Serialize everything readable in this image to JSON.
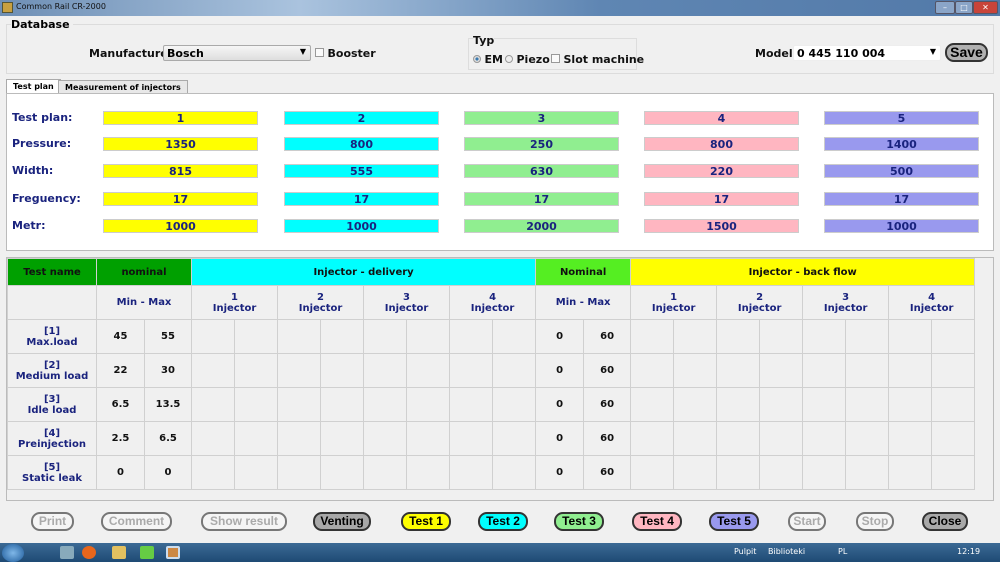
{
  "window": {
    "title": "Common Rail CR-2000",
    "minimize": "–",
    "maximize": "□",
    "close": "✕"
  },
  "database": {
    "label": "Database",
    "manufacture_label": "Manufacture:",
    "manufacture_value": "Bosch",
    "booster_label": "Booster",
    "typ_label": "Typ",
    "typ_options": [
      "EM",
      "Piezo"
    ],
    "typ_selected": "EM",
    "slot_label": "Slot machine",
    "model_label": "Model:",
    "model_value": "0 445 110 004",
    "save": "Save"
  },
  "tabs": [
    "Test plan",
    "Measurement of injectors"
  ],
  "plan": {
    "row_labels": [
      "Test plan:",
      "Pressure:",
      "Width:",
      "Freguency:",
      "Metr:"
    ],
    "colors": [
      "#ffff00",
      "#00ffff",
      "#90ee90",
      "#ffb6c1",
      "#9999ee"
    ],
    "columns": [
      [
        "1",
        "1350",
        "815",
        "17",
        "1000"
      ],
      [
        "2",
        "800",
        "555",
        "17",
        "1000"
      ],
      [
        "3",
        "250",
        "630",
        "17",
        "2000"
      ],
      [
        "4",
        "800",
        "220",
        "17",
        "1500"
      ],
      [
        "5",
        "1400",
        "500",
        "17",
        "1000"
      ]
    ]
  },
  "table": {
    "h_test": "Test name",
    "h_nominal": "nominal",
    "h_delivery": "Injector - delivery",
    "h_nominal2": "Nominal",
    "h_backflow": "Injector - back flow",
    "minmax": "Min - Max",
    "inj": [
      "1",
      "2",
      "3",
      "4"
    ],
    "inj_word": "Injector",
    "rows": [
      {
        "id": "[1]",
        "name": "Max.load",
        "min": "45",
        "max": "55",
        "bmin": "0",
        "bmax": "60"
      },
      {
        "id": "[2]",
        "name": "Medium load",
        "min": "22",
        "max": "30",
        "bmin": "0",
        "bmax": "60"
      },
      {
        "id": "[3]",
        "name": "Idle load",
        "min": "6.5",
        "max": "13.5",
        "bmin": "0",
        "bmax": "60"
      },
      {
        "id": "[4]",
        "name": "Preinjection",
        "min": "2.5",
        "max": "6.5",
        "bmin": "0",
        "bmax": "60"
      },
      {
        "id": "[5]",
        "name": "Static leak",
        "min": "0",
        "max": "0",
        "bmin": "0",
        "bmax": "60"
      }
    ]
  },
  "buttons": [
    {
      "label": "Print",
      "bg": "",
      "dis": true
    },
    {
      "label": "Comment",
      "bg": "",
      "dis": true
    },
    {
      "label": "Show result",
      "bg": "",
      "dis": true
    },
    {
      "label": "Venting",
      "bg": "#a8a8a8",
      "dis": false
    },
    {
      "label": "Test 1",
      "bg": "#ffff00",
      "dis": false
    },
    {
      "label": "Test 2",
      "bg": "#00ffff",
      "dis": false
    },
    {
      "label": "Test 3",
      "bg": "#90ee90",
      "dis": false
    },
    {
      "label": "Test 4",
      "bg": "#ffb6c1",
      "dis": false
    },
    {
      "label": "Test 5",
      "bg": "#9999ee",
      "dis": false
    },
    {
      "label": "Start",
      "bg": "",
      "dis": true
    },
    {
      "label": "Stop",
      "bg": "",
      "dis": true
    },
    {
      "label": "Close",
      "bg": "#a8a8a8",
      "dis": false
    }
  ],
  "taskbar": {
    "desktop": "Pulpit",
    "libraries": "Biblioteki",
    "lang": "PL",
    "clock": "12:19"
  }
}
